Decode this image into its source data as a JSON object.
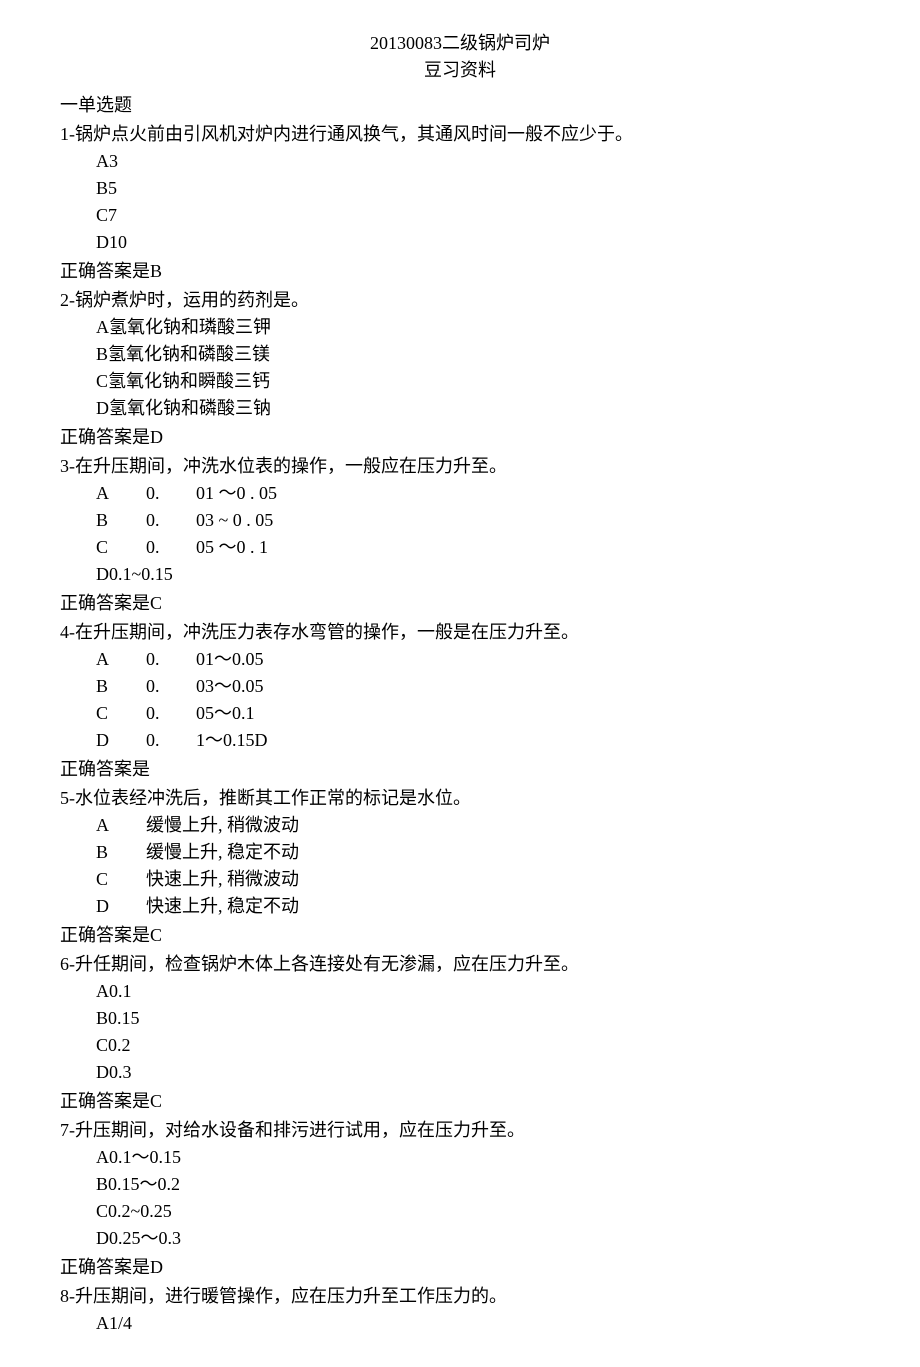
{
  "title": "20130083二级锅炉司炉",
  "subtitle": "豆习资料",
  "section": "一单选题",
  "questions": [
    {
      "stem": "1-锅炉点火前由引风机对炉内进行通风换气，其通风时间一般不应少于。",
      "options": [
        "A3",
        "B5",
        "C7",
        "D10"
      ],
      "answer": "正确答案是B"
    },
    {
      "stem": "2-锅炉煮炉时，运用的药剂是。",
      "options": [
        "A氢氧化钠和璘酸三钾",
        "B氢氧化钠和磷酸三镁",
        "C氢氧化钠和瞬酸三钙",
        "D氢氧化钠和磷酸三钠"
      ],
      "answer": "正确答案是D"
    },
    {
      "stem": "3-在升压期间，冲洗水位表的操作，一般应在压力升至。",
      "tableOptions": [
        {
          "a": "A",
          "b": "0.",
          "c": "01 ～0  . 05"
        },
        {
          "a": "B",
          "b": "0.",
          "c": "03 ~  0 . 05"
        },
        {
          "a": "C",
          "b": "0.",
          "c": "05 ～0  . 1"
        }
      ],
      "extraOption": "D0.1~0.15",
      "answer": "正确答案是C"
    },
    {
      "stem": "4-在升压期间，冲洗压力表存水弯管的操作，一般是在压力升至。",
      "tableOptions": [
        {
          "a": "A",
          "b": "0.",
          "c": "01～0.05"
        },
        {
          "a": "B",
          "b": "0.",
          "c": "03～0.05"
        },
        {
          "a": "C",
          "b": "0.",
          "c": "05～0.1"
        },
        {
          "a": "D",
          "b": "0.",
          "c": "1～0.15D"
        }
      ],
      "answer": "正确答案是"
    },
    {
      "stem": "5-水位表经冲洗后，推断其工作正常的标记是水位。",
      "tableOptions2": [
        {
          "a": "A",
          "c": "缓慢上升,  稍微波动"
        },
        {
          "a": "B",
          "c": "缓慢上升,  稳定不动"
        },
        {
          "a": "C",
          "c": "快速上升,  稍微波动"
        },
        {
          "a": "D",
          "c": "快速上升,  稳定不动"
        }
      ],
      "answer": "正确答案是C"
    },
    {
      "stem": "6-升任期间，检查锅炉木体上各连接处有无渗漏，应在压力升至。",
      "options": [
        "A0.1",
        "B0.15",
        "C0.2",
        "D0.3"
      ],
      "answer": "正确答案是C"
    },
    {
      "stem": "7-升压期间，对给水设备和排污进行试用，应在压力升至。",
      "options": [
        "A0.1～0.15",
        "B0.15～0.2",
        "C0.2~0.25",
        "D0.25～0.3"
      ],
      "answer": "正确答案是D"
    },
    {
      "stem": "8-升压期间，进行暖管操作，应在压力升至工作压力的。",
      "options": [
        "A1/4"
      ],
      "answer": null
    }
  ]
}
